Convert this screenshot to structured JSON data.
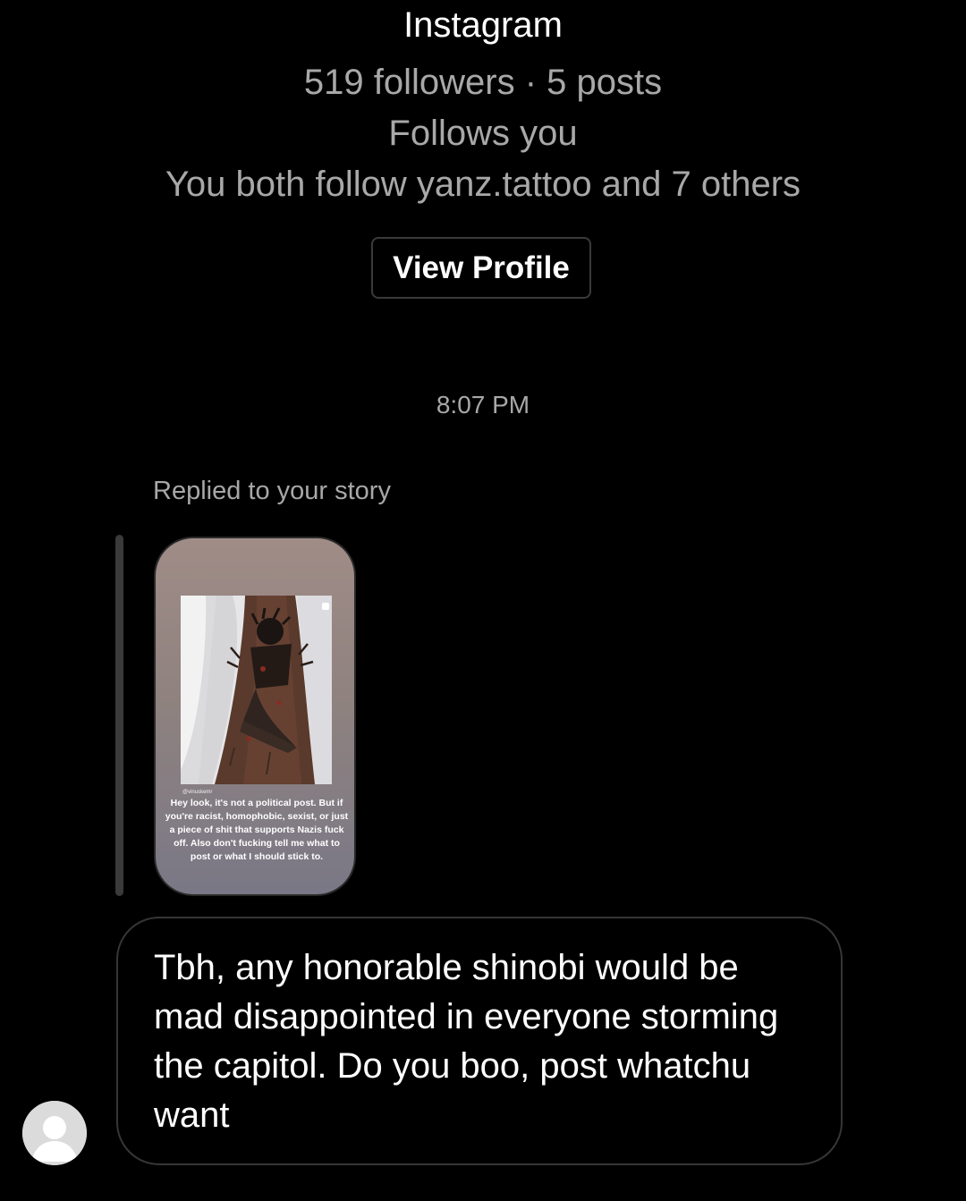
{
  "profile_header": {
    "platform": "Instagram",
    "stats": "519 followers · 5 posts",
    "follows_status": "Follows you",
    "mutual": "You both follow yanz.tattoo and 7 others",
    "view_profile_label": "View Profile"
  },
  "thread": {
    "timestamp": "8:07 PM",
    "story_reply_label": "Replied to your story",
    "story": {
      "handle": "@vinuskemr",
      "caption": "Hey look, it's not a political post. But if you're racist, homophobic, sexist, or just a piece of shit that supports Nazis fuck off. Also don't fucking tell me what to post or what I should stick to."
    },
    "message": "Tbh, any honorable shinobi would be mad disappointed in everyone storming the capitol. Do you boo, post whatchu want"
  },
  "icons": {
    "avatar": "default-avatar-icon"
  },
  "colors": {
    "background": "#000000",
    "primary_text": "#ffffff",
    "secondary_text": "#a8a8a8",
    "bubble_border": "#363636",
    "reply_bar": "#3a3a3a"
  }
}
